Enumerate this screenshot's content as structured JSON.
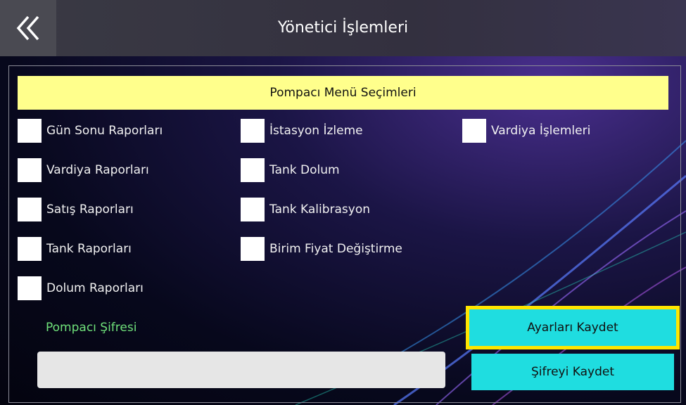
{
  "header": {
    "title": "Yönetici İşlemleri",
    "back_icon": "double-chevron-left-icon"
  },
  "section": {
    "title": "Pompacı Menü Seçimleri"
  },
  "options": {
    "col1": [
      "Gün Sonu Raporları",
      "Vardiya Raporları",
      "Satış Raporları",
      "Tank Raporları",
      "Dolum Raporları"
    ],
    "col2": [
      "İstasyon İzleme",
      "Tank Dolum",
      "Tank Kalibrasyon",
      "Birim Fiyat Değiştirme"
    ],
    "col3": [
      "Vardiya İşlemleri"
    ]
  },
  "password": {
    "label": "Pompacı Şifresi",
    "value": ""
  },
  "buttons": {
    "save_settings": "Ayarları Kaydet",
    "save_password": "Şifreyi Kaydet"
  },
  "colors": {
    "section_bar": "#ffff8c",
    "button": "#1fdde0",
    "focus_border": "#ffe600",
    "password_label": "#6fe07a"
  }
}
